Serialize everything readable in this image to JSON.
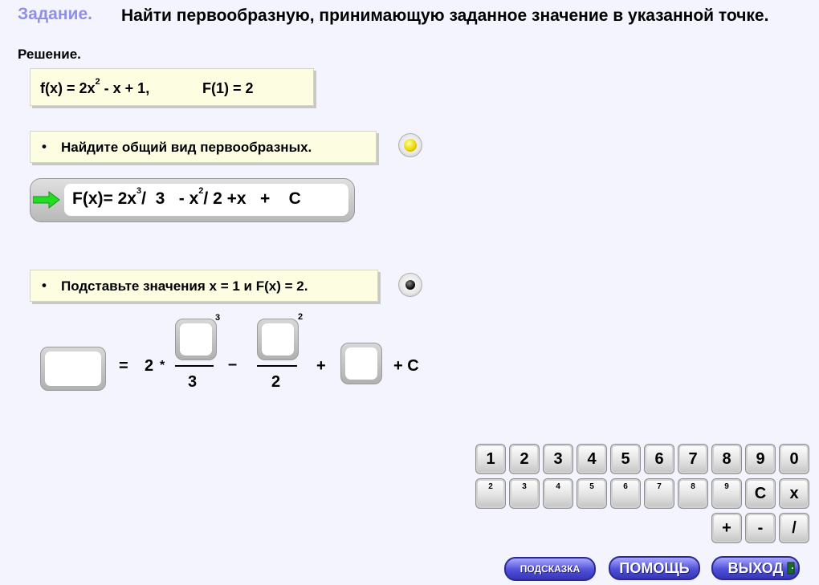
{
  "task": {
    "label": "Задание.",
    "text": "Найти первообразную, принимающую заданное значение в указанной точке."
  },
  "solution_label": "Решение.",
  "given": {
    "f_prefix": "f(x) = 2x",
    "f_exp": "2",
    "f_suffix": " - x + 1,",
    "condition": "F(1) = 2"
  },
  "step1": {
    "bullet": "•",
    "text": "Найдите общий вид первообразных."
  },
  "answer": {
    "part1": "F(x)= 2x",
    "exp1": "3",
    "part2": "/  3   - x",
    "exp2": "2",
    "part3": "/ 2 +x   +    C"
  },
  "step2": {
    "bullet": "•",
    "text": "Подставьте значения x = 1 и F(x) = 2."
  },
  "equation": {
    "equals": "=",
    "coef": "2",
    "times": "*",
    "exp1": "3",
    "den1": "3",
    "minus": "–",
    "exp2": "2",
    "den2": "2",
    "plus": "+",
    "tail": "+ C"
  },
  "keypad": {
    "digits": [
      "1",
      "2",
      "3",
      "4",
      "5",
      "6",
      "7",
      "8",
      "9",
      "0"
    ],
    "powers": [
      "2",
      "3",
      "4",
      "5",
      "6",
      "7",
      "8",
      "9"
    ],
    "clear": "C",
    "x": "x",
    "ops": [
      "+",
      "-",
      "/"
    ]
  },
  "buttons": {
    "hint": "ПОДСКАЗКА",
    "help": "ПОМОЩЬ",
    "exit": "ВЫХОД"
  },
  "colors": {
    "background": "#f4f4fe",
    "task_label": "#8f8fea",
    "panel": "#fdfde2",
    "button_blue": "#4040c8",
    "arrow_green": "#22dd22"
  }
}
